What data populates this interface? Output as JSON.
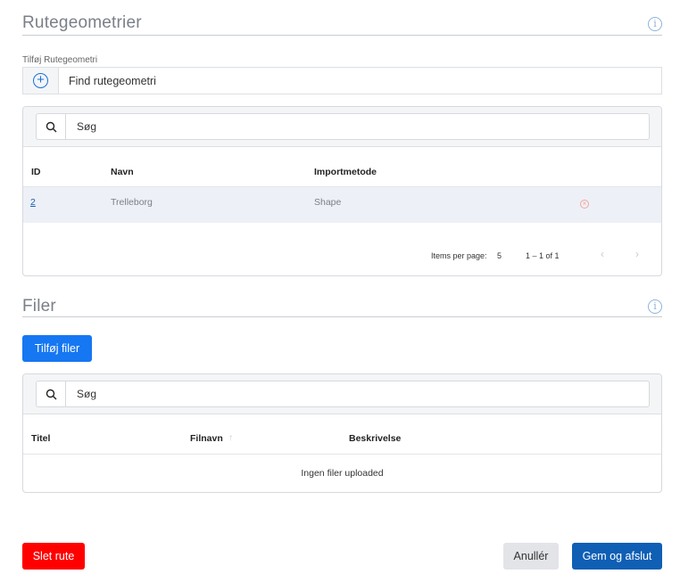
{
  "routes_section": {
    "title": "Rutegeometrier",
    "info_icon": "i",
    "add_label": "Tilføj Rutegeometri",
    "add_placeholder": "Find rutegeometri",
    "search_placeholder": "Søg",
    "columns": [
      "ID",
      "Navn",
      "Importmetode"
    ],
    "rows": [
      {
        "id": "2",
        "name": "Trelleborg",
        "import_method": "Shape"
      }
    ],
    "paginator": {
      "items_per_page_label": "Items per page:",
      "items_per_page_value": "5",
      "range": "1 – 1 of 1"
    }
  },
  "files_section": {
    "title": "Filer",
    "info_icon": "i",
    "add_files_button": "Tilføj filer",
    "search_placeholder": "Søg",
    "columns": [
      "Titel",
      "Filnavn",
      "Beskrivelse"
    ],
    "empty_message": "Ingen filer uploaded"
  },
  "footer": {
    "delete_button": "Slet rute",
    "cancel_button": "Anullér",
    "save_button": "Gem og afslut"
  },
  "colors": {
    "primary": "#1677f2",
    "danger": "#ff0000",
    "save": "#0f5fb5"
  }
}
